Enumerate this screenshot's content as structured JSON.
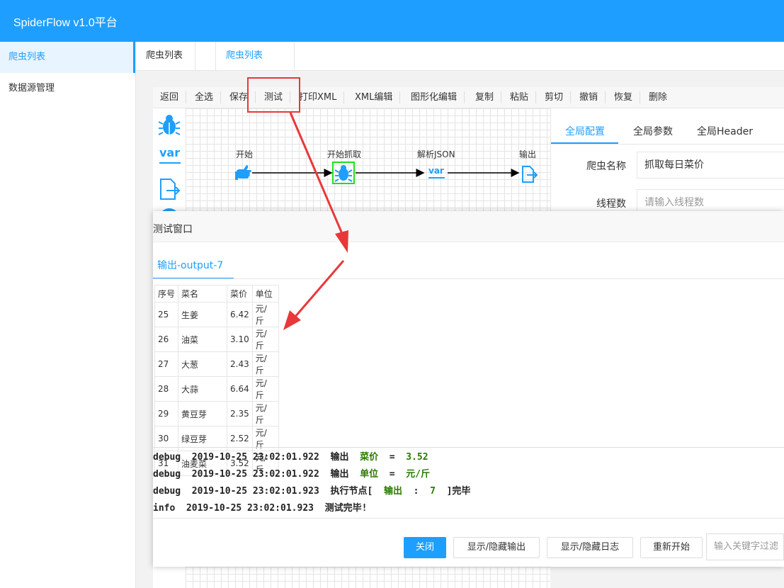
{
  "app": {
    "title": "SpiderFlow v1.0平台",
    "accent": "#1e9fff"
  },
  "sidebar": {
    "items": [
      {
        "label": "爬虫列表",
        "active": true
      },
      {
        "label": "数据源管理",
        "active": false
      }
    ]
  },
  "tabs": [
    {
      "label": "爬虫列表"
    },
    {
      "label": "爬虫列表"
    }
  ],
  "toolbar": {
    "buttons": [
      "返回",
      "全选",
      "保存",
      "测试",
      "打印XML",
      "XML编辑",
      "图形化编辑",
      "复制",
      "粘贴",
      "剪切",
      "撤销",
      "恢复",
      "删除"
    ]
  },
  "palette": {
    "icons": [
      "spider-icon",
      "variable-icon",
      "output-icon"
    ],
    "var_text": "var"
  },
  "flow": {
    "nodes": [
      {
        "label": "开始",
        "icon": "hand-pointer-icon"
      },
      {
        "label": "开始抓取",
        "icon": "spider-icon"
      },
      {
        "label": "解析JSON",
        "icon": "variable-icon",
        "icon_text": "var"
      },
      {
        "label": "输出",
        "icon": "output-icon"
      }
    ]
  },
  "config": {
    "tabs": [
      "全局配置",
      "全局参数",
      "全局Header"
    ],
    "fields": [
      {
        "label": "爬虫名称",
        "value": "抓取每日菜价",
        "placeholder": ""
      },
      {
        "label": "线程数",
        "value": "",
        "placeholder": "请输入线程数"
      }
    ]
  },
  "test_window": {
    "title": "测试窗口",
    "output_tab": "输出-output-7",
    "table": {
      "headers": [
        "序号",
        "菜名",
        "菜价",
        "单位"
      ],
      "rows": [
        [
          "25",
          "生姜",
          "6.42",
          "元/斤"
        ],
        [
          "26",
          "油菜",
          "3.10",
          "元/斤"
        ],
        [
          "27",
          "大葱",
          "2.43",
          "元/斤"
        ],
        [
          "28",
          "大蒜",
          "6.64",
          "元/斤"
        ],
        [
          "29",
          "黄豆芽",
          "2.35",
          "元/斤"
        ],
        [
          "30",
          "绿豆芽",
          "2.52",
          "元/斤"
        ],
        [
          "31",
          "油麦菜",
          "3.52",
          "元/斤"
        ]
      ]
    },
    "log": [
      {
        "pre": "debug  2019-10-25 23:02:01.922  输出  ",
        "hl": "菜价",
        "post": "  =  ",
        "val": "3.52",
        "end": ""
      },
      {
        "pre": "debug  2019-10-25 23:02:01.922  输出  ",
        "hl": "单位",
        "post": "  =  ",
        "val": "元/斤",
        "end": ""
      },
      {
        "pre": "debug  2019-10-25 23:02:01.923  执行节点[  ",
        "hl": "输出",
        "post": "  :  ",
        "val": "7",
        "end": "  ]完毕"
      },
      {
        "pre": "info  2019-10-25 23:02:01.923  测试完毕!",
        "hl": "",
        "post": "",
        "val": "",
        "end": ""
      }
    ],
    "buttons": [
      "关闭",
      "显示/隐藏输出",
      "显示/隐藏日志",
      "重新开始"
    ],
    "filter_placeholder": "输入关键字过滤"
  }
}
